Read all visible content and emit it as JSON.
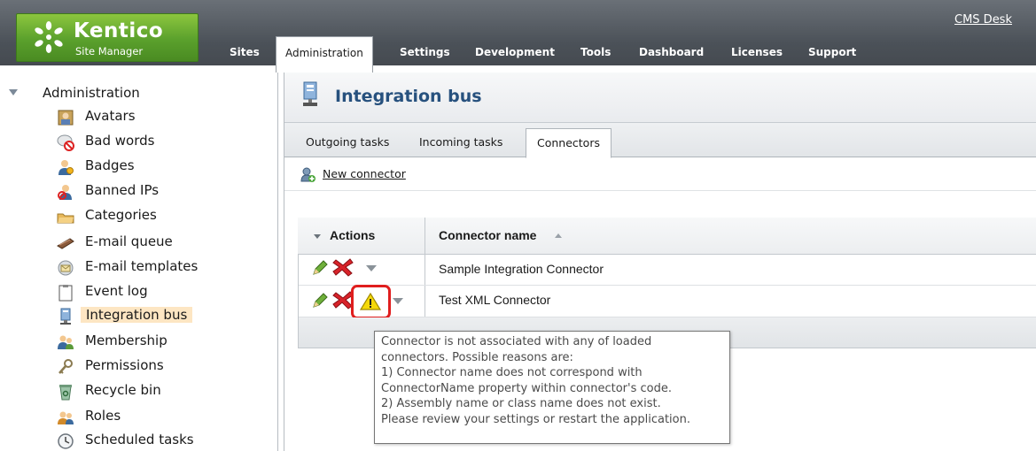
{
  "header": {
    "logo": {
      "name": "Kentico",
      "subtitle": "Site Manager"
    },
    "cms_desk_link": "CMS Desk",
    "nav_tabs": [
      {
        "label": "Sites",
        "active": false
      },
      {
        "label": "Administration",
        "active": true
      },
      {
        "label": "Settings",
        "active": false
      },
      {
        "label": "Development",
        "active": false
      },
      {
        "label": "Tools",
        "active": false
      },
      {
        "label": "Dashboard",
        "active": false
      },
      {
        "label": "Licenses",
        "active": false
      },
      {
        "label": "Support",
        "active": false
      }
    ]
  },
  "sidebar": {
    "root_label": "Administration",
    "items": [
      {
        "label": "Avatars",
        "icon": "avatar-icon"
      },
      {
        "label": "Bad words",
        "icon": "bad-words-icon"
      },
      {
        "label": "Badges",
        "icon": "badge-icon"
      },
      {
        "label": "Banned IPs",
        "icon": "banned-ip-icon"
      },
      {
        "label": "Categories",
        "icon": "categories-icon"
      },
      {
        "label": "E-mail queue",
        "icon": "email-queue-icon"
      },
      {
        "label": "E-mail templates",
        "icon": "email-template-icon"
      },
      {
        "label": "Event log",
        "icon": "event-log-icon"
      },
      {
        "label": "Integration bus",
        "icon": "integration-bus-icon",
        "selected": true
      },
      {
        "label": "Membership",
        "icon": "membership-icon"
      },
      {
        "label": "Permissions",
        "icon": "permissions-icon"
      },
      {
        "label": "Recycle bin",
        "icon": "recycle-bin-icon"
      },
      {
        "label": "Roles",
        "icon": "roles-icon"
      },
      {
        "label": "Scheduled tasks",
        "icon": "scheduled-tasks-icon"
      }
    ]
  },
  "main": {
    "title": "Integration bus",
    "tabs": [
      {
        "label": "Outgoing tasks",
        "active": false
      },
      {
        "label": "Incoming tasks",
        "active": false
      },
      {
        "label": "Connectors",
        "active": true
      }
    ],
    "new_connector_label": "New connector",
    "grid": {
      "columns": {
        "actions": "Actions",
        "name": "Connector name"
      },
      "rows": [
        {
          "name": "Sample Integration Connector",
          "warning": false
        },
        {
          "name": "Test XML Connector",
          "warning": true
        }
      ]
    },
    "tooltip_lines": [
      "Connector is not associated with any of loaded",
      "connectors. Possible reasons are:",
      " 1) Connector name does not correspond with",
      "ConnectorName property within connector's code.",
      " 2) Assembly name or class name does not exist.",
      "Please review your settings or restart the application."
    ]
  },
  "colors": {
    "header_bg": "#4b5158",
    "logo_green": "#5aa02c",
    "title_blue": "#27517e",
    "selected_item_bg": "#fde6c3",
    "highlight_red": "#e01e1e",
    "warning_yellow": "#f5d90a"
  }
}
